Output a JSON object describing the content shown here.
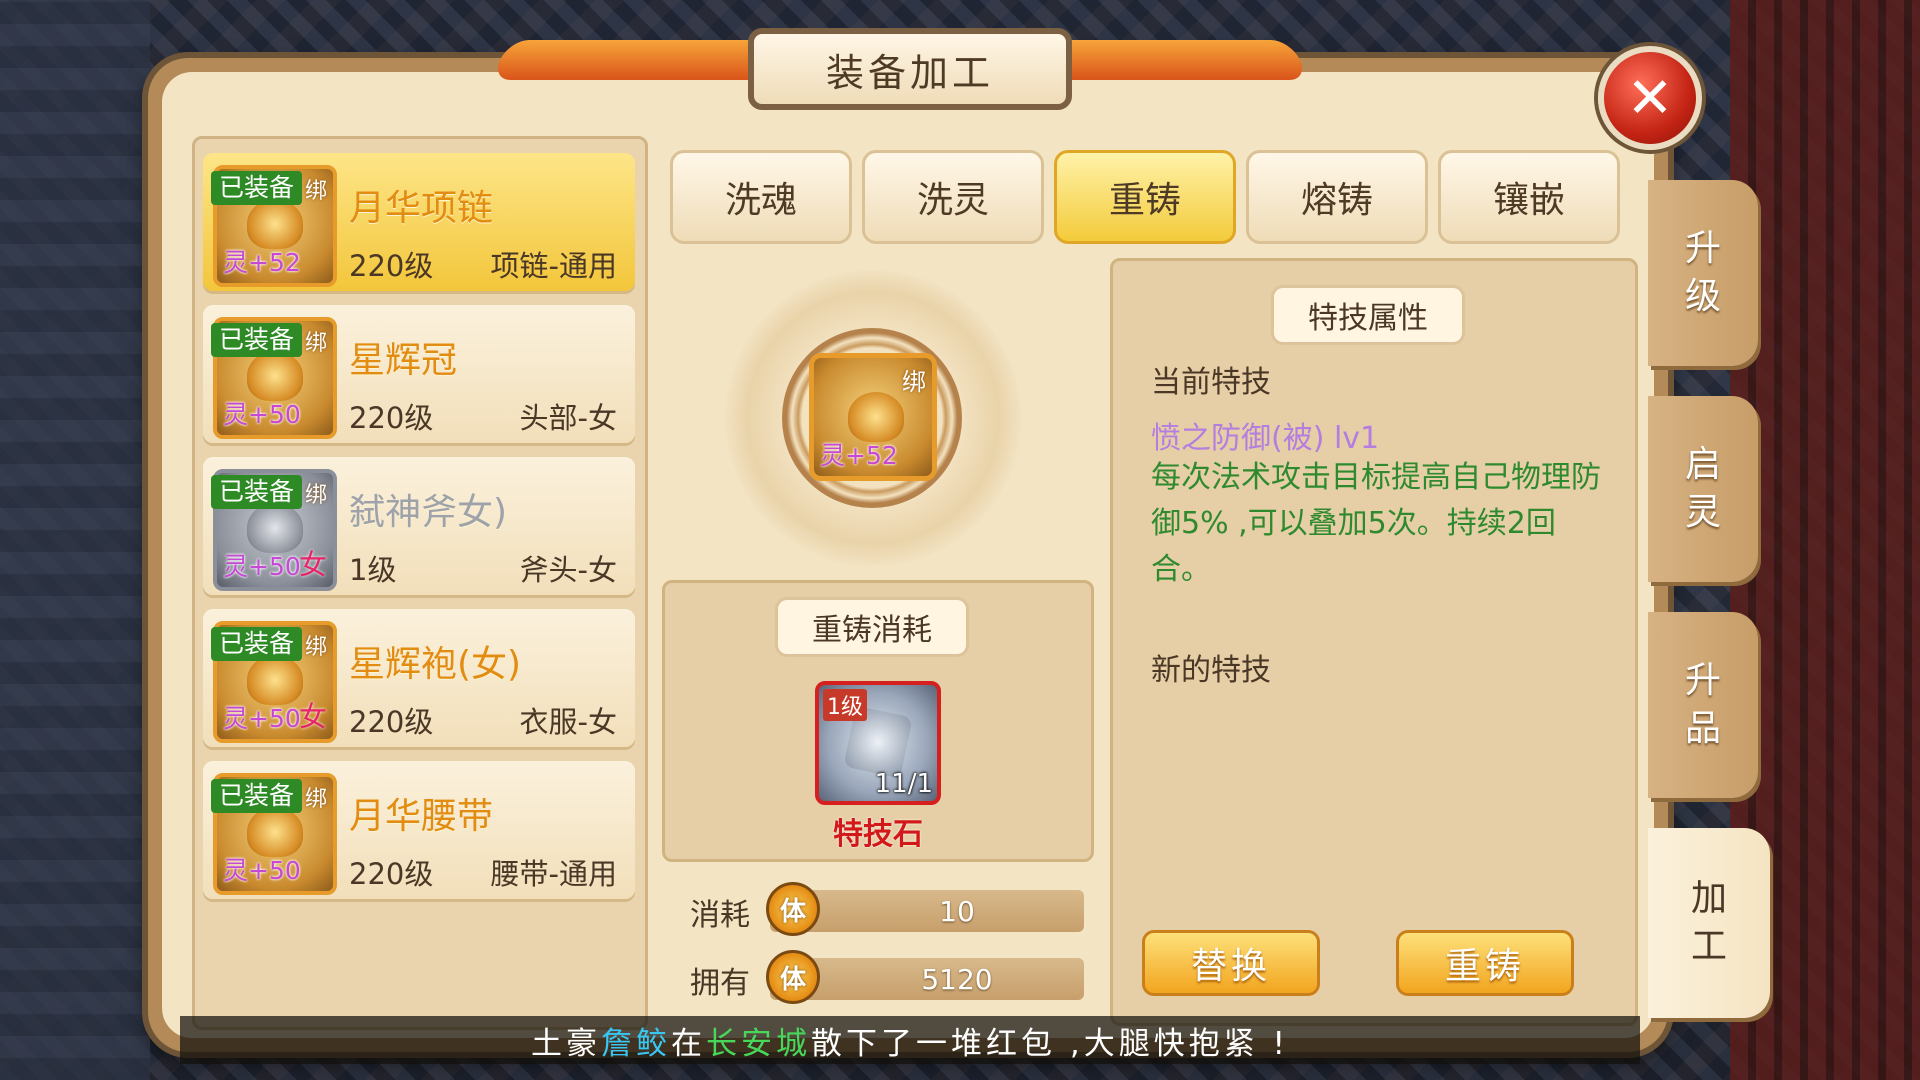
{
  "title": "装备加工",
  "close_label": "✕",
  "equipment": [
    {
      "tag": "已装备",
      "bind": "绑",
      "spirit": "灵+52",
      "gender": "",
      "name": "月华项链",
      "level": "220级",
      "type": "项链-通用",
      "selected": true,
      "gray": false
    },
    {
      "tag": "已装备",
      "bind": "绑",
      "spirit": "灵+50",
      "gender": "",
      "name": "星辉冠",
      "level": "220级",
      "type": "头部-女",
      "selected": false,
      "gray": false
    },
    {
      "tag": "已装备",
      "bind": "绑",
      "spirit": "灵+50",
      "gender": "女",
      "name": "弑神斧女)",
      "level": "1级",
      "type": "斧头-女",
      "selected": false,
      "gray": true
    },
    {
      "tag": "已装备",
      "bind": "绑",
      "spirit": "灵+50",
      "gender": "女",
      "name": "星辉袍(女)",
      "level": "220级",
      "type": "衣服-女",
      "selected": false,
      "gray": false
    },
    {
      "tag": "已装备",
      "bind": "绑",
      "spirit": "灵+50",
      "gender": "",
      "name": "月华腰带",
      "level": "220级",
      "type": "腰带-通用",
      "selected": false,
      "gray": false
    }
  ],
  "tabs": [
    "洗魂",
    "洗灵",
    "重铸",
    "熔铸",
    "镶嵌"
  ],
  "active_tab": "重铸",
  "selected_item": {
    "bind": "绑",
    "spirit": "灵+52"
  },
  "cost": {
    "title": "重铸消耗",
    "item_level": "1级",
    "item_count": "11/1",
    "item_name": "特技石"
  },
  "resources": {
    "consume_label": "消耗",
    "consume_icon": "体",
    "consume_value": "10",
    "own_label": "拥有",
    "own_icon": "体",
    "own_value": "5120"
  },
  "attributes": {
    "title": "特技属性",
    "current_label": "当前特技",
    "skill_name": "愤之防御(被) lv1",
    "skill_desc": "每次法术攻击目标提高自己物理防御5% ,可以叠加5次。持续2回合。",
    "new_label": "新的特技"
  },
  "buttons": {
    "replace": "替换",
    "recast": "重铸"
  },
  "side_tabs": [
    {
      "c1": "升",
      "c2": "级"
    },
    {
      "c1": "启",
      "c2": "灵"
    },
    {
      "c1": "升",
      "c2": "品"
    },
    {
      "c1": "加",
      "c2": "工"
    }
  ],
  "marquee": {
    "part1": "土豪",
    "player": "詹鲛",
    "part2": "在",
    "city": "长安城",
    "part3": "散下了一堆红包 ,大腿快抱紧 !"
  },
  "colors": {
    "frame": "#b38a58",
    "panel": "#f3e4c4",
    "tab_active": "#f3cb3b",
    "item_name": "#e28c12",
    "skill_name": "#b47de0",
    "skill_desc": "#2f8a2f",
    "stone_name": "#d21818",
    "marquee_player": "#39c6f2",
    "marquee_city": "#47d85a"
  }
}
